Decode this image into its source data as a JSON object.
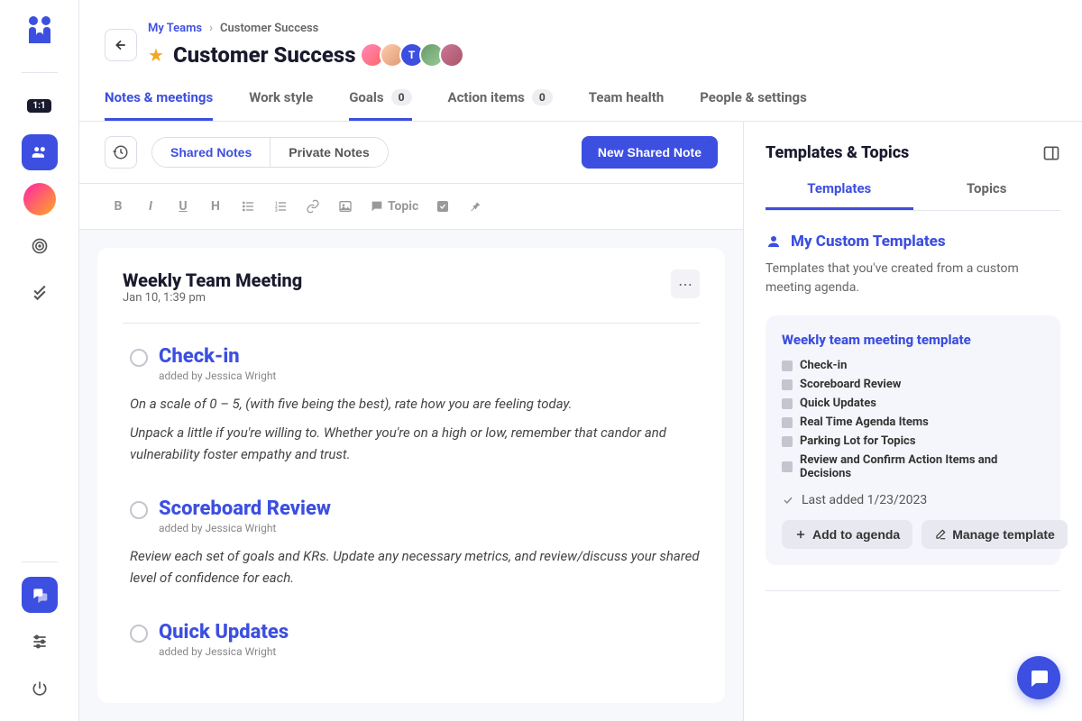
{
  "breadcrumb": {
    "root": "My Teams",
    "current": "Customer Success"
  },
  "page_title": "Customer Success",
  "avatars": {
    "letter": "T"
  },
  "tabs": [
    {
      "label": "Notes & meetings",
      "active": true
    },
    {
      "label": "Work style"
    },
    {
      "label": "Goals",
      "count": "0"
    },
    {
      "label": "Action items",
      "count": "0"
    },
    {
      "label": "Team health"
    },
    {
      "label": "People & settings"
    }
  ],
  "notes_toggle": {
    "shared": "Shared Notes",
    "private": "Private Notes"
  },
  "new_note_btn": "New Shared Note",
  "format_topic": "Topic",
  "note": {
    "title": "Weekly Team Meeting",
    "date": "Jan 10, 1:39 pm",
    "items": [
      {
        "title": "Check-in",
        "by": "added by Jessica Wright",
        "body1": "On a scale of 0 – 5, (with five being the best), rate how you are feeling today.",
        "body2": "Unpack a little if you're willing to. Whether you're on a high or low, remember that candor and vulnerability foster empathy and trust."
      },
      {
        "title": "Scoreboard Review",
        "by": "added by Jessica Wright",
        "body1": "Review each set of goals and KRs. Update any necessary metrics, and review/discuss your shared level of confidence for each."
      },
      {
        "title": "Quick Updates",
        "by": "added by Jessica Wright"
      }
    ]
  },
  "right_panel": {
    "title": "Templates & Topics",
    "tabs": {
      "templates": "Templates",
      "topics": "Topics"
    },
    "section_title": "My Custom Templates",
    "section_desc": "Templates that you've created from a custom meeting agenda.",
    "template": {
      "name": "Weekly team meeting template",
      "items": [
        "Check-in",
        "Scoreboard Review",
        "Quick Updates",
        "Real Time Agenda Items",
        "Parking Lot for Topics",
        "Review and Confirm Action Items and Decisions"
      ],
      "last_added": "Last added 1/23/2023",
      "add_btn": "Add to agenda",
      "manage_btn": "Manage template"
    }
  },
  "sidebar": {
    "one_on_one": "1:1"
  }
}
